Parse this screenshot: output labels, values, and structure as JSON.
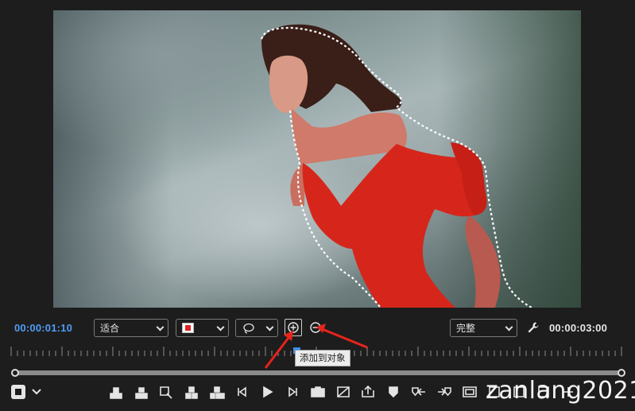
{
  "monitor": {
    "current_timecode": "00:00:01:10",
    "duration_timecode": "00:00:03:00",
    "zoom": {
      "selected": "适合"
    },
    "quality": {
      "selected": "完整"
    },
    "mask_color": "#d22222",
    "tooltip": "添加到对象"
  },
  "colors": {
    "accent_blue": "#4f9df7",
    "annotation_red": "#e8231b",
    "background": "#1d1d1d"
  },
  "transport_icons": [
    "mark-in-icon",
    "mark-out-icon",
    "go-to-in-icon",
    "lift-icon",
    "extract-icon",
    "step-back-icon",
    "play-icon",
    "step-forward-icon",
    "camera-icon",
    "comparison-icon",
    "export-frame-icon",
    "add-marker-icon",
    "go-to-prev-marker-icon",
    "go-to-next-marker-icon",
    "safe-margins-icon",
    "trim-icon",
    "button-editor-icon",
    "insert-icon",
    "more-icon"
  ],
  "watermark": "zanlang2021"
}
